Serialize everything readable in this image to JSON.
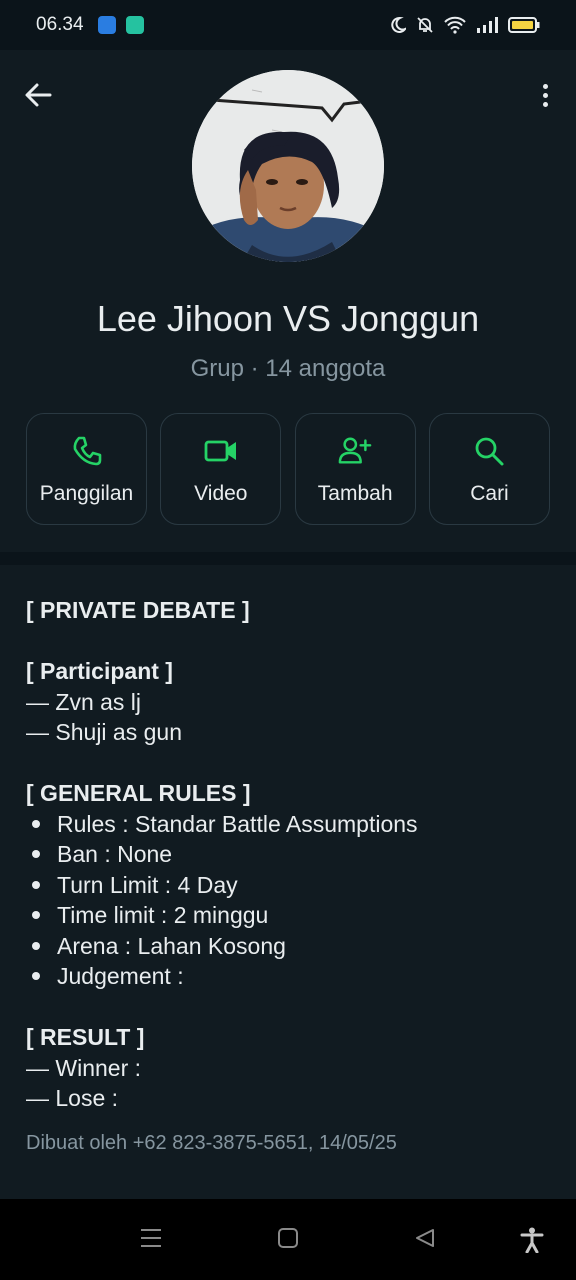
{
  "status_bar": {
    "time": "06.34"
  },
  "group": {
    "name": "Lee Jihoon VS Jonggun",
    "subtitle": "Grup · 14 anggota"
  },
  "actions": [
    {
      "label": "Panggilan",
      "icon": "phone-icon"
    },
    {
      "label": "Video",
      "icon": "video-icon"
    },
    {
      "label": "Tambah",
      "icon": "add-person-icon"
    },
    {
      "label": "Cari",
      "icon": "search-icon"
    }
  ],
  "accent_color": "#25d366",
  "description": {
    "title": "[ PRIVATE DEBATE ]",
    "participant_header": "[ Participant ]",
    "participants": [
      "— Zvn as lj",
      "— Shuji as gun"
    ],
    "rules_header": "[ GENERAL RULES ]",
    "rules": [
      "Rules : Standar Battle Assumptions",
      "Ban : None",
      "Turn Limit : 4 Day",
      "Time limit : 2 minggu",
      "Arena : Lahan Kosong",
      "Judgement :"
    ],
    "result_header": "[ RESULT ]",
    "results": [
      "— Winner :",
      "— Lose :"
    ],
    "created_by": "Dibuat oleh +62 823-3875-5651, 14/05/25"
  }
}
